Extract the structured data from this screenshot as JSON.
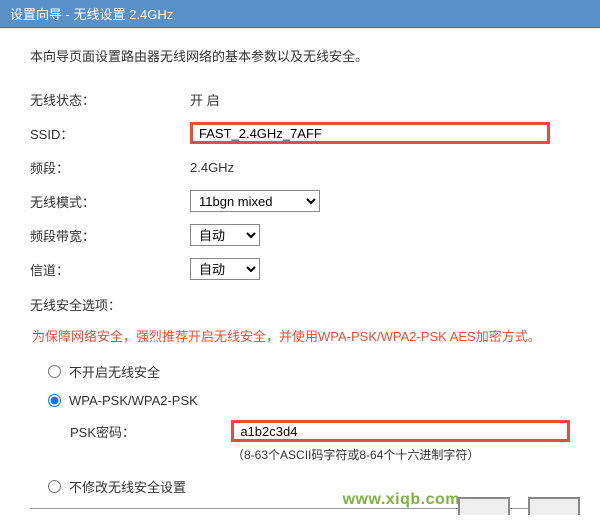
{
  "title": "设置向导 - 无线设置 2.4GHz",
  "description": "本向导页面设置路由器无线网络的基本参数以及无线安全。",
  "fields": {
    "wirelessStatus": {
      "label": "无线状态：",
      "value": "开 启"
    },
    "ssid": {
      "label": "SSID：",
      "value": "FAST_2.4GHz_7AFF"
    },
    "band": {
      "label": "频段：",
      "value": "2.4GHz"
    },
    "mode": {
      "label": "无线模式：",
      "value": "11bgn mixed"
    },
    "bandwidth": {
      "label": "频段带宽：",
      "value": "自动"
    },
    "channel": {
      "label": "信道：",
      "value": "自动"
    }
  },
  "securitySection": {
    "title": "无线安全选项：",
    "warning": "为保障网络安全，强烈推荐开启无线安全，并使用WPA-PSK/WPA2-PSK AES加密方式。",
    "options": {
      "disable": "不开启无线安全",
      "wpapsk": "WPA-PSK/WPA2-PSK",
      "nochange": "不修改无线安全设置"
    },
    "psk": {
      "label": "PSK密码：",
      "value": "a1b2c3d4",
      "hint": "（8-63个ASCII码字符或8-64个十六进制字符）"
    }
  },
  "watermark": "www.xiqb.com"
}
